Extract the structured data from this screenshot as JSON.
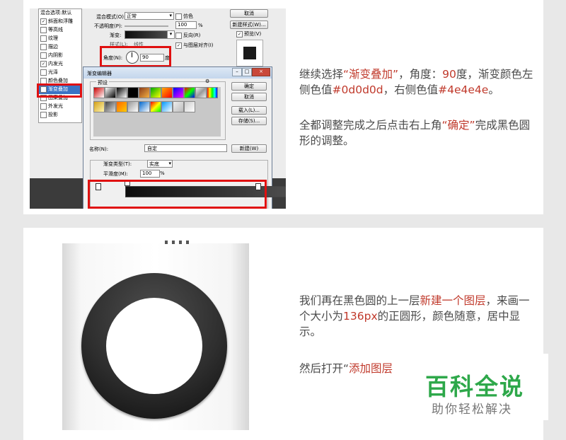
{
  "card1": {
    "text1": {
      "p1": "继续选择",
      "h1": "“渐变叠加”",
      "p2": "，角度：",
      "h2": "90",
      "p3": "度，渐变颜色左侧色值",
      "h3": "#0d0d0d",
      "p4": "，右侧色值",
      "h4": "#4e4e4e",
      "p5": "。"
    },
    "text2": {
      "p1": "全都调整完成之后点击右上角",
      "h1": "“确定”",
      "p2": "完成黑色圆形的调整。"
    },
    "styles_panel": {
      "header": "混合选项:默认",
      "items": [
        {
          "label": "斜面和浮雕",
          "checked": true
        },
        {
          "label": "等高线",
          "checked": false
        },
        {
          "label": "纹理",
          "checked": false
        },
        {
          "label": "描边",
          "checked": false
        },
        {
          "label": "内阴影",
          "checked": false
        },
        {
          "label": "内发光",
          "checked": true
        },
        {
          "label": "光泽",
          "checked": false
        },
        {
          "label": "颜色叠加",
          "checked": false
        },
        {
          "label": "渐变叠加",
          "checked": true
        },
        {
          "label": "图案叠加",
          "checked": false
        },
        {
          "label": "外发光",
          "checked": false
        },
        {
          "label": "投影",
          "checked": false
        }
      ]
    },
    "layer_style": {
      "blend_label": "混合模式(O):",
      "blend_value": "正常",
      "dither": "仿色",
      "opacity_label": "不透明度(P):",
      "opacity_value": "100",
      "gradient_label": "渐变:",
      "reverse": "反向(R)",
      "style_label": "样式(L):",
      "style_value": "线性",
      "align": "与图层对齐(I)",
      "angle_label": "角度(N):",
      "angle_value": "90",
      "angle_unit": "度",
      "cancel": "取消",
      "new_style": "新建样式(W)...",
      "preview": "预览(V)"
    },
    "gradient_editor": {
      "title": "渐变编辑器",
      "presets_label": "预设",
      "ok": "确定",
      "cancel": "取消",
      "load": "载入(L)...",
      "save": "存储(S)...",
      "name_label": "名称(N):",
      "name_value": "自定",
      "new_button": "新建(W)",
      "type_label": "渐变类型(T):",
      "type_value": "实底",
      "smooth_label": "平滑度(M):",
      "smooth_value": "100",
      "smooth_unit": "%",
      "left_color": "#0d0d0d",
      "right_color": "#4e4e4e"
    }
  },
  "card2": {
    "text1": {
      "p1": "我们再在黑色圆的上一层",
      "h1": "新建一个图层",
      "p2": "，来画一个大小为",
      "h2": "136px",
      "p3": "的正圆形，颜色随意，居中显示。"
    },
    "text2": {
      "p1": "然后打开“",
      "h1": "添加图层"
    }
  },
  "watermark": {
    "title": "百科全说",
    "subtitle": "助你轻松解决"
  },
  "colors": {
    "highlight": "#c0392b",
    "watermark_green": "#2ea84a",
    "red_box": "#e01010"
  }
}
